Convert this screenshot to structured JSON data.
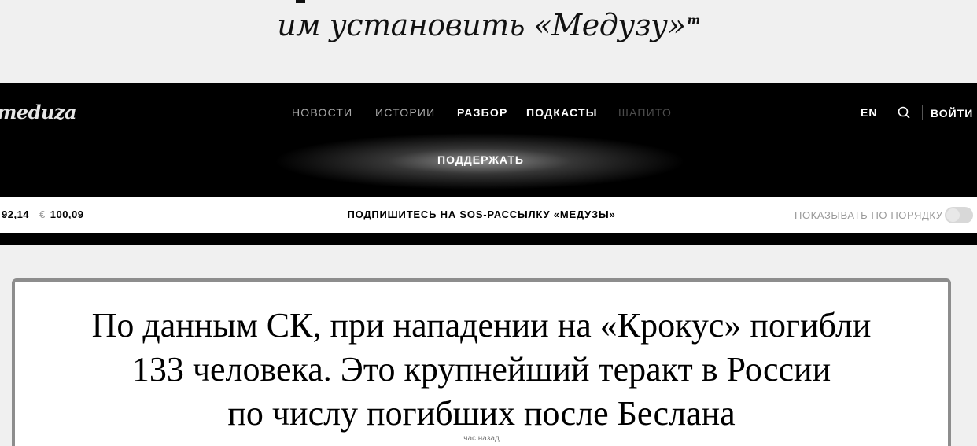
{
  "promo": {
    "text": "им установить «Медузу»",
    "superscript": "m"
  },
  "header": {
    "logo": "meduza",
    "nav": [
      "НОВОСТИ",
      "ИСТОРИИ",
      "РАЗБОР",
      "ПОДКАСТЫ",
      "ШАПИТО"
    ],
    "lang": "EN",
    "login": "ВОЙТИ",
    "support": "ПОДДЕРЖАТЬ"
  },
  "ticker": {
    "usd_value": "92,14",
    "eur_symbol": "€",
    "eur_value": "100,09",
    "subscribe": "ПОДПИШИТЕСЬ НА SOS-РАССЫЛКУ «МЕДУЗЫ»",
    "order_label": "ПОКАЗЫВАТЬ ПО ПОРЯДКУ",
    "order_toggle_on": false
  },
  "card": {
    "headline_line1": "По данным СК, при нападении на «Крокус» погибли",
    "headline_line2": "133 человека. Это крупнейший теракт в России",
    "headline_line3": "по числу погибших после Беслана",
    "time": "час назад"
  }
}
